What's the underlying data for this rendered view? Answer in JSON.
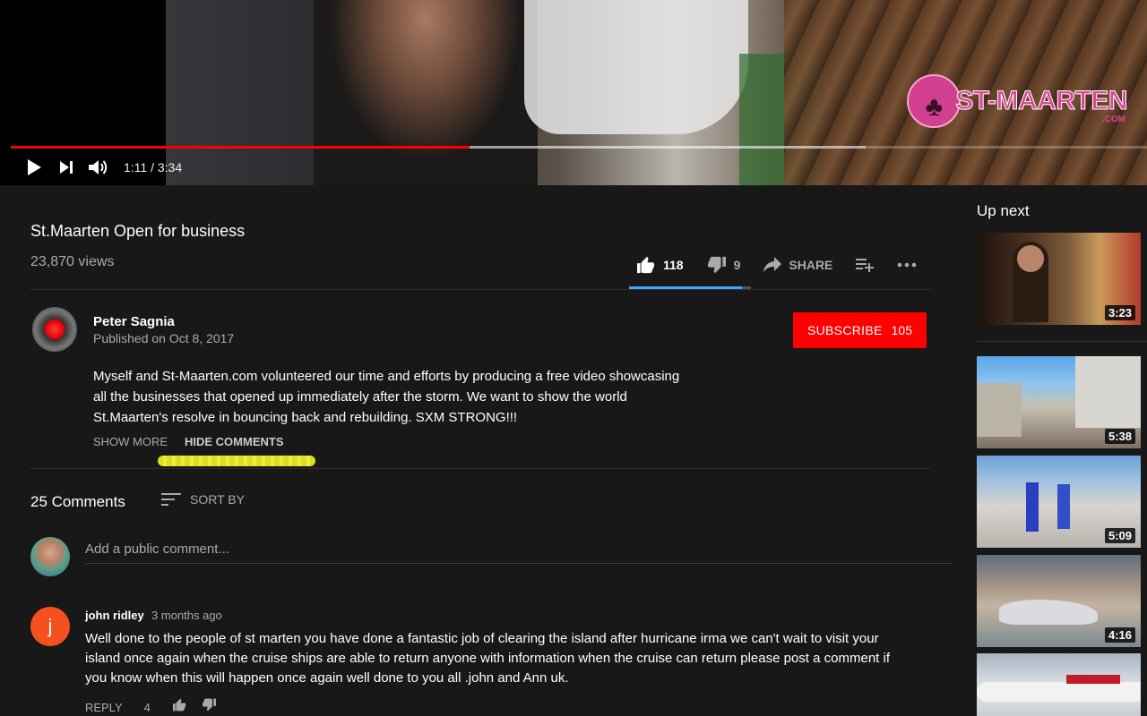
{
  "player": {
    "time_display": "1:11 / 3:34",
    "progress_played": 0.404,
    "progress_buffered": 0.752,
    "logo_text": "ST-MAARTEN",
    "logo_tld": ".COM"
  },
  "video": {
    "title": "St.Maarten Open for business",
    "views": "23,870 views",
    "likes": "118",
    "dislikes": "9",
    "share_label": "SHARE",
    "like_ratio": 0.929
  },
  "channel": {
    "name": "Peter Sagnia",
    "published": "Published on Oct 8, 2017",
    "subscribe_label": "SUBSCRIBE",
    "subscriber_count": "105"
  },
  "description": {
    "lines": [
      "Myself and St-Maarten.com volunteered our time and efforts by producing a free video showcasing",
      "all the businesses that opened up immediately after the storm.  We want to show the world",
      "St.Maarten's resolve in bouncing back and rebuilding.  SXM STRONG!!!"
    ],
    "show_more": "SHOW MORE",
    "hide_comments": "HIDE COMMENTS"
  },
  "comments": {
    "count": "25 Comments",
    "sort_label": "SORT BY",
    "input_placeholder": "Add a public comment...",
    "items": [
      {
        "avatar_letter": "j",
        "author": "john ridley",
        "time": "3 months ago",
        "lines": [
          "Well done to the people of st marten you have done a fantastic job of clearing the island after hurricane irma we can't wait to visit your",
          "island once again when the cruise ships are able to return anyone with information when the cruise can return please post a comment if",
          "you know when this will happen once again well done to you all .john and Ann uk."
        ],
        "reply_label": "REPLY",
        "likes": "4"
      }
    ]
  },
  "sidebar": {
    "heading": "Up next",
    "videos": [
      {
        "duration": "3:23"
      },
      {
        "duration": "5:38"
      },
      {
        "duration": "5:09"
      },
      {
        "duration": "4:16"
      },
      {
        "duration": ""
      }
    ]
  },
  "colors": {
    "accent_red": "#ff0000",
    "sentiment_blue": "#3ea6ff",
    "background": "#181818"
  }
}
